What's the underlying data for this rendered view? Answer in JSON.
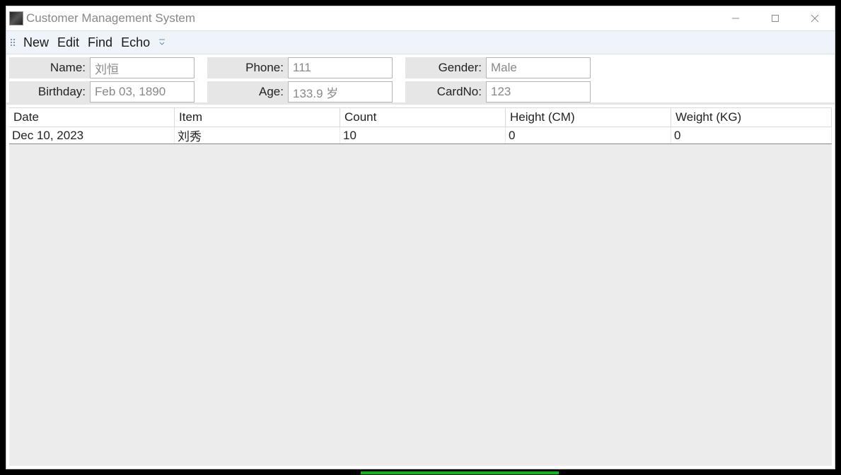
{
  "window": {
    "title": "Customer Management System"
  },
  "menu": {
    "new": "New",
    "edit": "Edit",
    "find": "Find",
    "echo": "Echo"
  },
  "fields": {
    "name_label": "Name:",
    "name_value": "刘恒",
    "phone_label": "Phone:",
    "phone_value": "111",
    "gender_label": "Gender:",
    "gender_value": "Male",
    "birthday_label": "Birthday:",
    "birthday_value": "Feb 03, 1890",
    "age_label": "Age:",
    "age_value": "133.9 岁",
    "cardno_label": "CardNo:",
    "cardno_value": "123"
  },
  "table": {
    "headers": {
      "date": "Date",
      "item": "Item",
      "count": "Count",
      "height": "Height (CM)",
      "weight": "Weight (KG)"
    },
    "rows": [
      {
        "date": "Dec 10, 2023",
        "item": "刘秀",
        "count": "10",
        "height": "0",
        "weight": "0"
      }
    ]
  }
}
